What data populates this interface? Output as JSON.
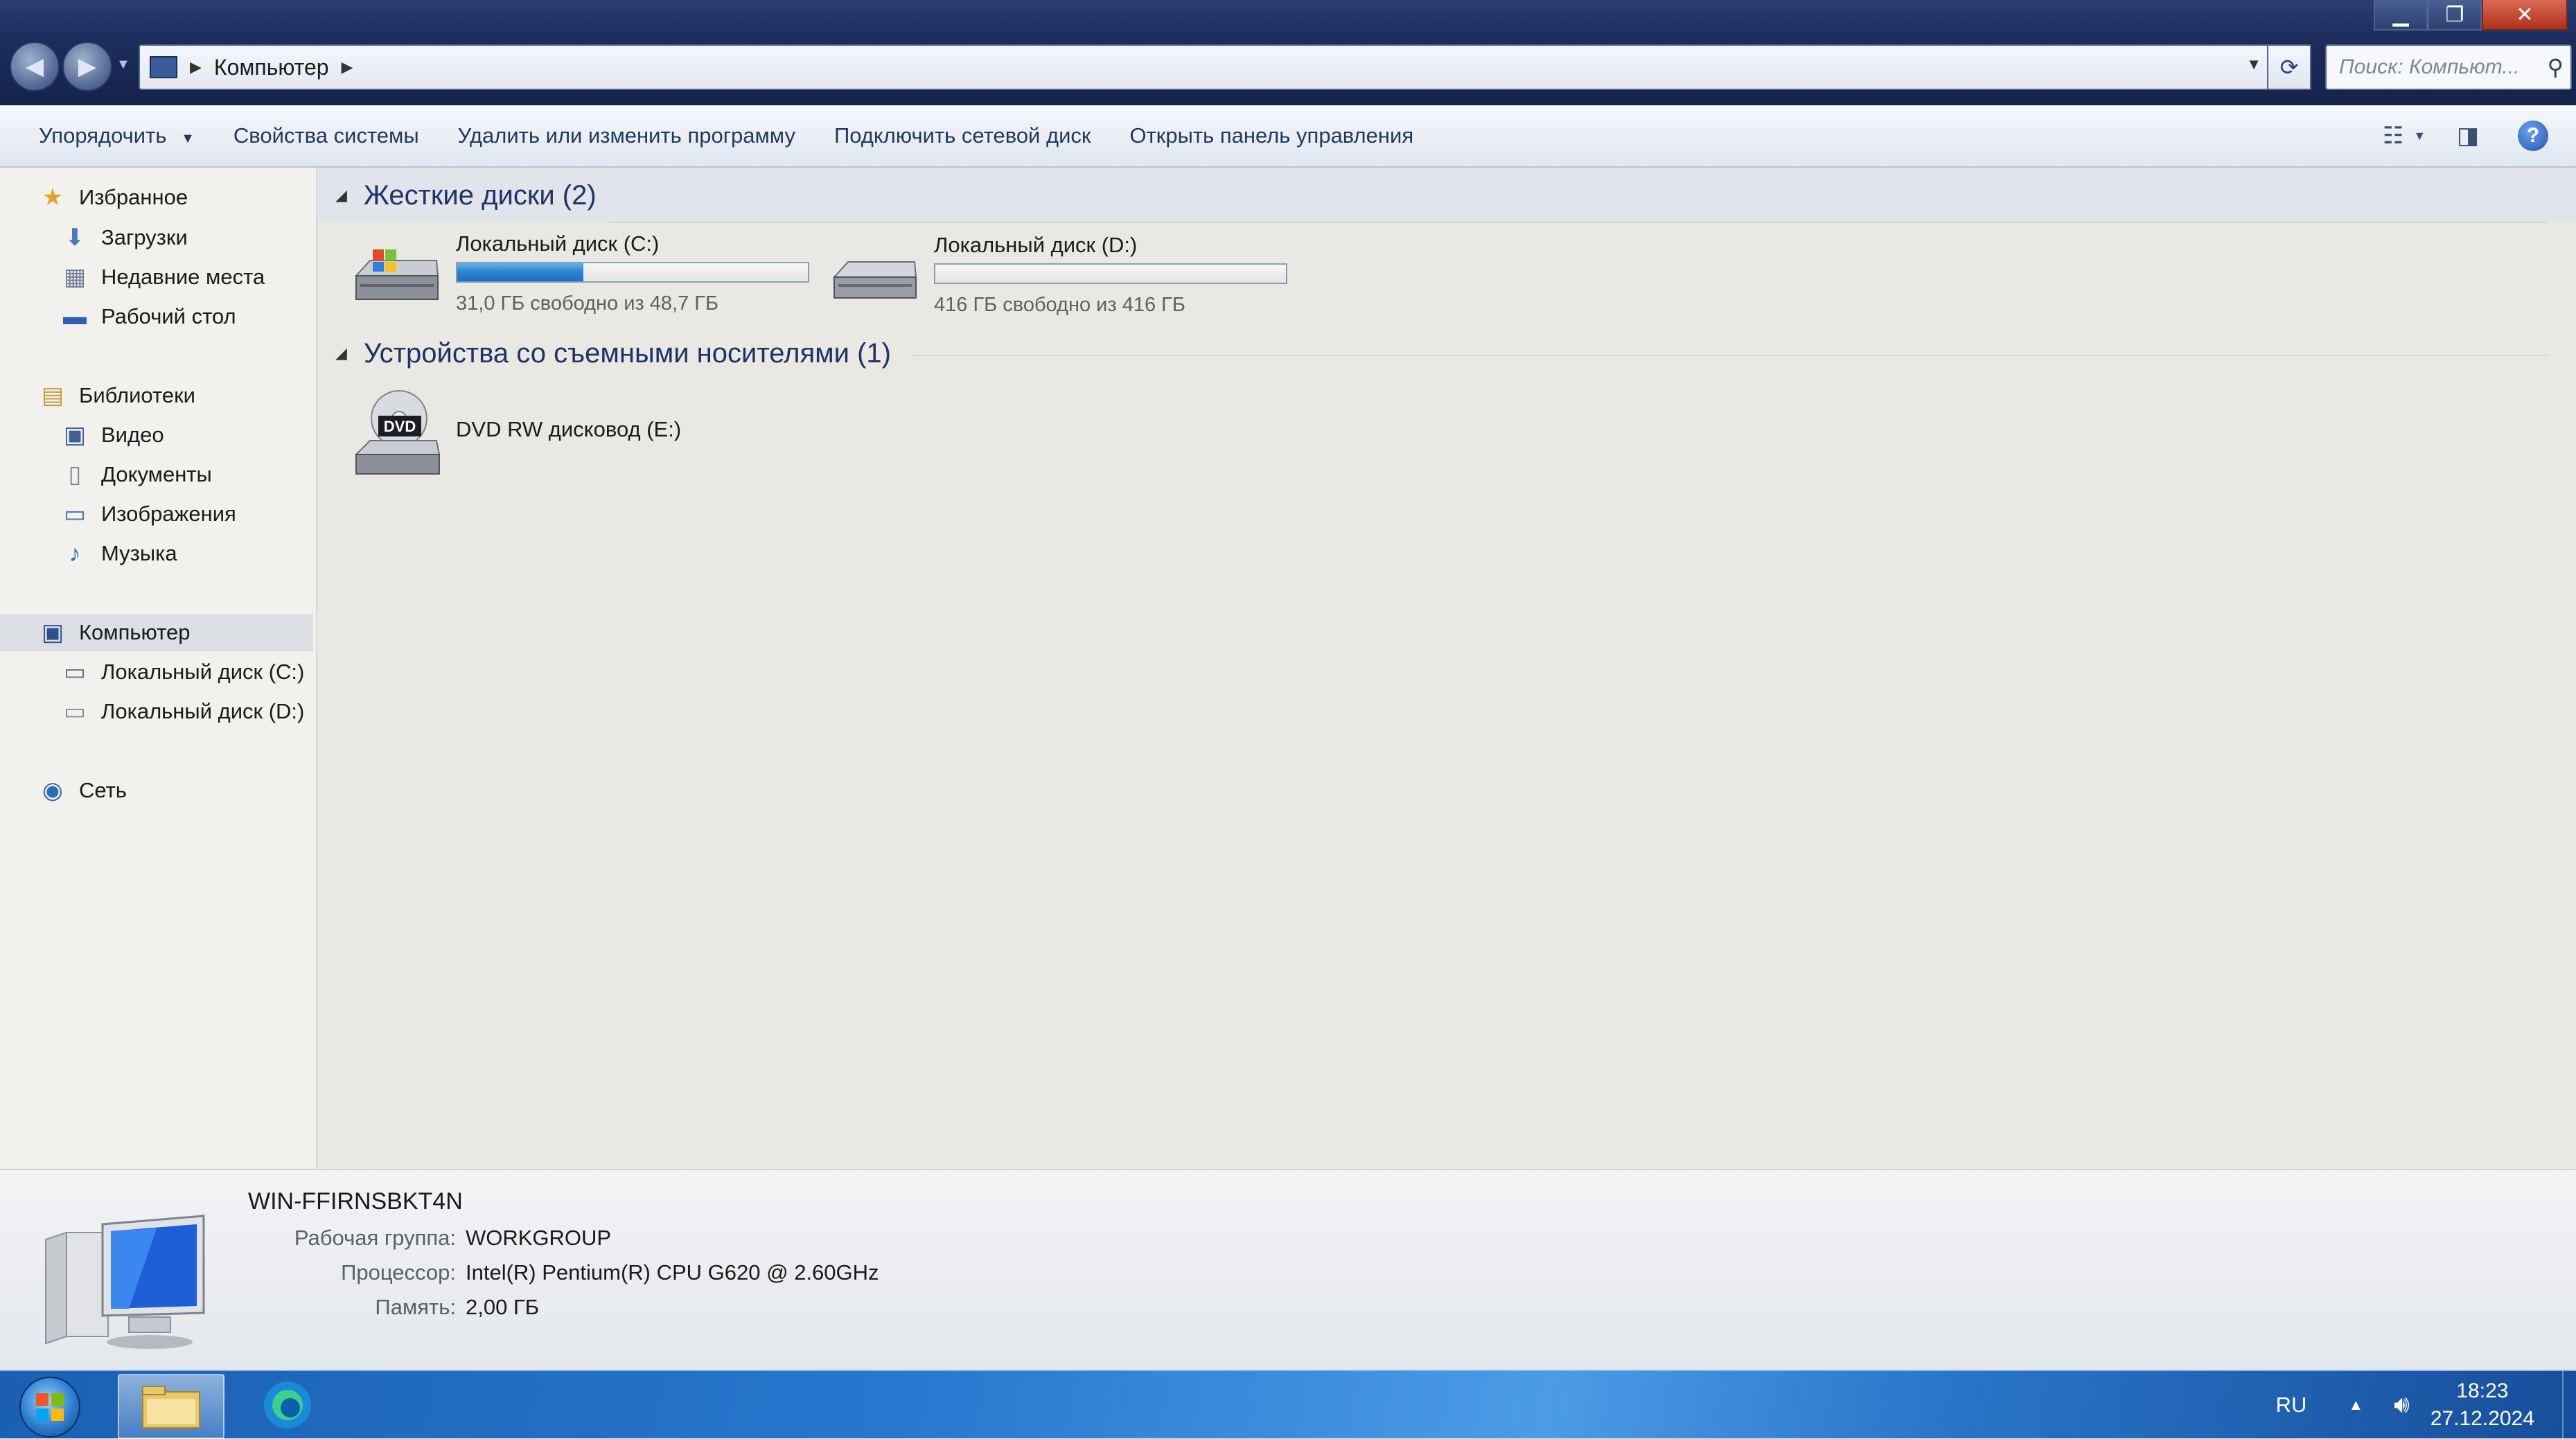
{
  "window": {
    "controls": {
      "minimize": "▁",
      "maximize": "❐",
      "close": "✕"
    }
  },
  "address": {
    "breadcrumb": "Компьютер",
    "search_placeholder": "Поиск: Компьют...",
    "back_icon": "arrow-left-icon",
    "forward_icon": "arrow-right-icon"
  },
  "toolbar": {
    "organize": "Упорядочить",
    "system_properties": "Свойства системы",
    "uninstall": "Удалить или изменить программу",
    "map_drive": "Подключить сетевой диск",
    "control_panel": "Открыть панель управления"
  },
  "sidebar": {
    "favorites": "Избранное",
    "downloads": "Загрузки",
    "recent": "Недавние места",
    "desktop": "Рабочий стол",
    "libraries": "Библиотеки",
    "video": "Видео",
    "documents": "Документы",
    "pictures": "Изображения",
    "music": "Музыка",
    "computer": "Компьютер",
    "drive_c": "Локальный диск (C:)",
    "drive_d": "Локальный диск (D:)",
    "network": "Сеть"
  },
  "main": {
    "hard_drives_header": "Жесткие диски (2)",
    "drives": [
      {
        "name": "Локальный диск (C:)",
        "free": "31,0 ГБ свободно из 48,7 ГБ",
        "used_fraction": 0.36
      },
      {
        "name": "Локальный диск (D:)",
        "free": "416 ГБ свободно из 416 ГБ",
        "used_fraction": 0.0
      }
    ],
    "removable_header": "Устройства со съемными носителями (1)",
    "dvd_label": "DVD RW дисковод (E:)",
    "dvd_icon_text": "DVD"
  },
  "details": {
    "computer_name": "WIN-FFIRNSBKT4N",
    "workgroup_label": "Рабочая группа:",
    "workgroup_value": "WORKGROUP",
    "cpu_label": "Процессор:",
    "cpu_value": "Intel(R) Pentium(R) CPU G620 @ 2.60GHz",
    "memory_label": "Память:",
    "memory_value": "2,00 ГБ"
  },
  "taskbar": {
    "language": "RU",
    "time": "18:23",
    "date": "27.12.2024"
  },
  "colors": {
    "accent": "#2e86d0",
    "header_text": "#1e3366",
    "taskbar": "#2877cf"
  }
}
